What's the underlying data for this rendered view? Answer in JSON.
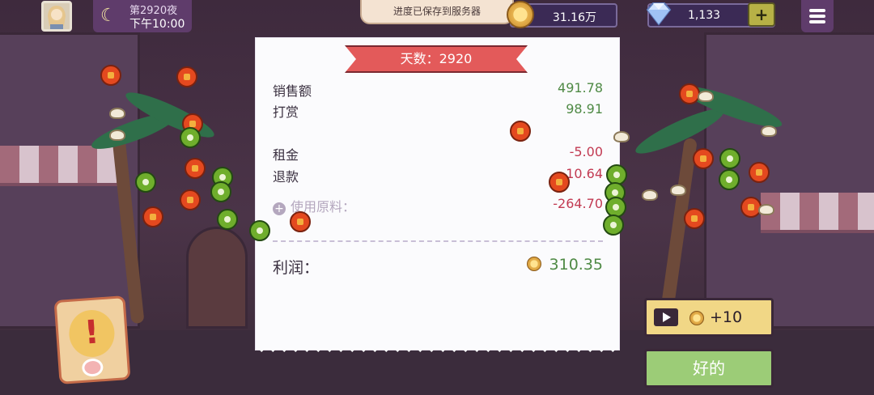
{
  "header": {
    "day_label": "第2920夜",
    "time_label": "下午10:00",
    "saved_toast": "进度已保存到服务器",
    "coins": "31.16万",
    "gems": "1,133",
    "add_label": "+"
  },
  "receipt": {
    "title": "天数：2920",
    "rows": [
      {
        "label": "销售额",
        "value": "491.78"
      },
      {
        "label": "打赏",
        "value": "98.91"
      },
      {
        "label": "租金",
        "value": "-5.00"
      },
      {
        "label": "退款",
        "value": "-10.64"
      },
      {
        "label": "使用原料：",
        "value": "-264.70"
      }
    ],
    "profit_label": "利润：",
    "profit_value": "310.35"
  },
  "buttons": {
    "ad_reward": "+10",
    "ok": "好的"
  },
  "alert": {
    "glyph": "!"
  },
  "colors": {
    "positive": "#4f8a45",
    "negative": "#c23a52",
    "ribbon": "#e35a5a",
    "ok_button": "#9ccc77",
    "ad_button": "#f1d786"
  }
}
